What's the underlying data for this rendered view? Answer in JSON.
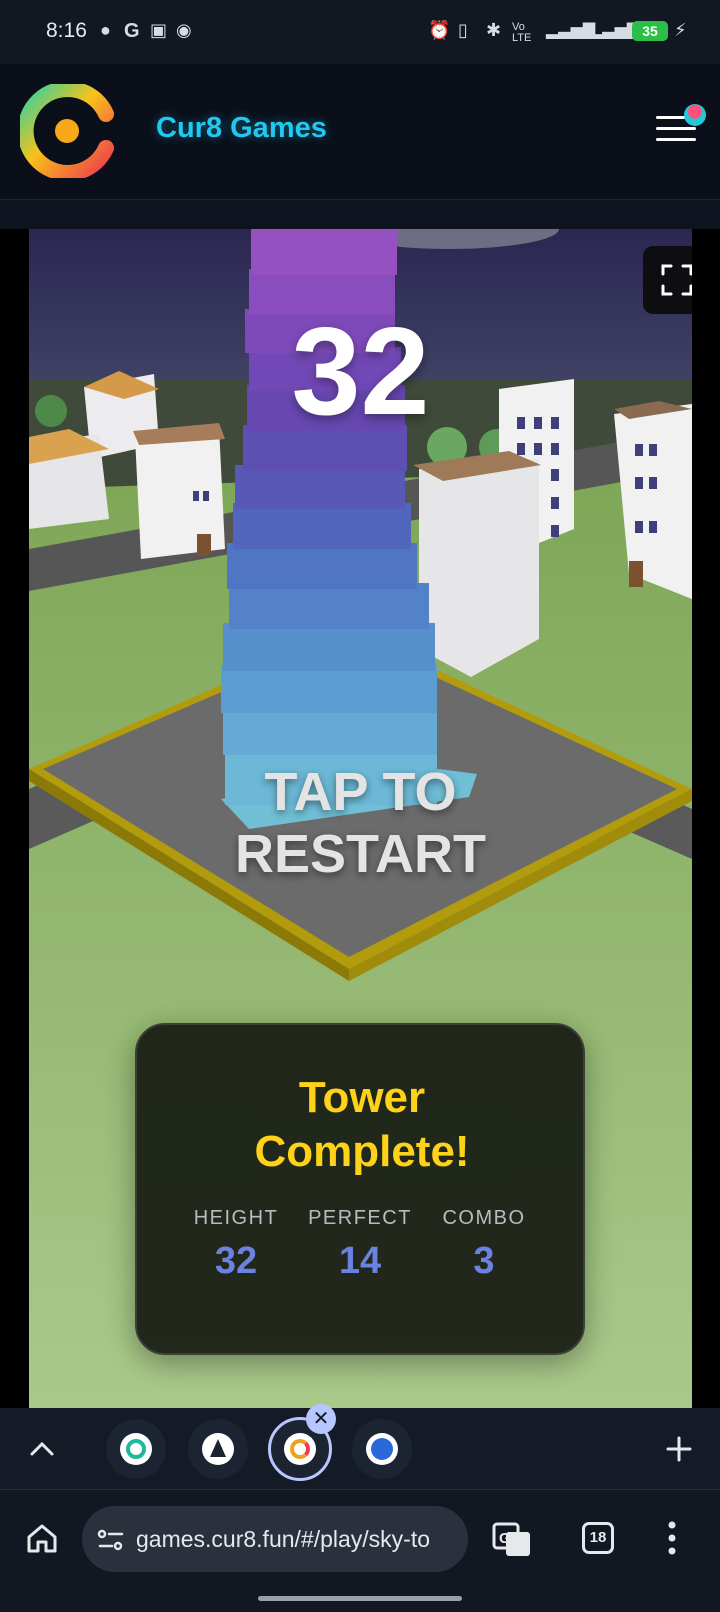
{
  "status_bar": {
    "time": "8:16",
    "battery": "35",
    "icons": [
      "chat-icon",
      "g-icon",
      "message-icon",
      "v-icon",
      "alarm-icon",
      "vibrate-icon",
      "bluetooth-icon",
      "volte-icon",
      "signal-4g-icon",
      "signal-icon",
      "charging-icon"
    ]
  },
  "header": {
    "brand": "Cur8 Games",
    "colors": {
      "brand": "#22c8f0",
      "background": "#0a0f1a"
    }
  },
  "game": {
    "score": "32",
    "tap_prompt_line1": "TAP TO",
    "tap_prompt_line2": "RESTART",
    "panel": {
      "title_line1": "Tower",
      "title_line2": "Complete!",
      "stats": [
        {
          "label": "HEIGHT",
          "value": "32"
        },
        {
          "label": "PERFECT",
          "value": "14"
        },
        {
          "label": "COMBO",
          "value": "3"
        }
      ]
    },
    "colors": {
      "title": "#ffd21a",
      "stat_value": "#6b82e0"
    }
  },
  "tab_strip": {
    "tabs": [
      {
        "name": "tab-chatgpt",
        "color": "#1fb89a"
      },
      {
        "name": "tab-labs",
        "color": "#ffffff"
      },
      {
        "name": "tab-cur8",
        "color": "#f0a020",
        "active": true
      },
      {
        "name": "tab-globe",
        "color": "#2a6ad8"
      }
    ]
  },
  "browser": {
    "url": "games.cur8.fun/#/play/sky-to",
    "tab_count": "18"
  }
}
